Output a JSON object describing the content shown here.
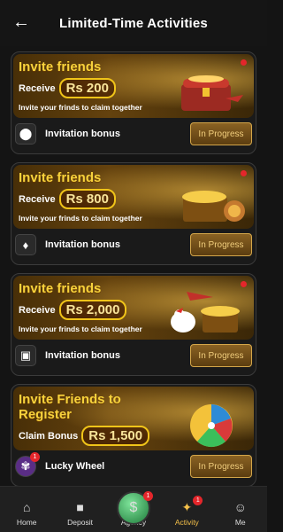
{
  "header": {
    "title": "Limited-Time Activities",
    "back_icon": "back-arrow-icon"
  },
  "cards": [
    {
      "title": "Invite friends",
      "receive_label": "Receive",
      "amount": "Rs 200",
      "subtitle": "Invite your frinds to claim together",
      "row_label": "Invitation bonus",
      "status": "In Progress",
      "row_icon": "gold-reward-icon",
      "has_dot": true
    },
    {
      "title": "Invite friends",
      "receive_label": "Receive",
      "amount": "Rs 800",
      "subtitle": "Invite your frinds to claim together",
      "row_label": "Invitation bonus",
      "status": "In Progress",
      "row_icon": "gem-reward-icon",
      "has_dot": true
    },
    {
      "title": "Invite friends",
      "receive_label": "Receive",
      "amount": "Rs 2,000",
      "subtitle": "Invite your frinds to claim together",
      "row_label": "Invitation bonus",
      "status": "In Progress",
      "row_icon": "chest-reward-icon",
      "has_dot": true
    },
    {
      "title": "Invite Friends to Register",
      "receive_label": "Claim Bonus",
      "amount": "Rs 1,500",
      "subtitle": "",
      "row_label": "Lucky Wheel",
      "status": "In Progress",
      "row_icon": "lucky-wheel-icon",
      "row_badge": "1",
      "has_dot": false
    }
  ],
  "bottom_nav": {
    "items": [
      {
        "label": "Home",
        "icon": "home-icon"
      },
      {
        "label": "Deposit",
        "icon": "deposit-icon"
      },
      {
        "label": "Agency",
        "icon": "agency-icon",
        "badge": "1"
      },
      {
        "label": "Activity",
        "icon": "activity-icon",
        "badge": "1",
        "active": true
      },
      {
        "label": "Me",
        "icon": "profile-icon"
      }
    ]
  }
}
